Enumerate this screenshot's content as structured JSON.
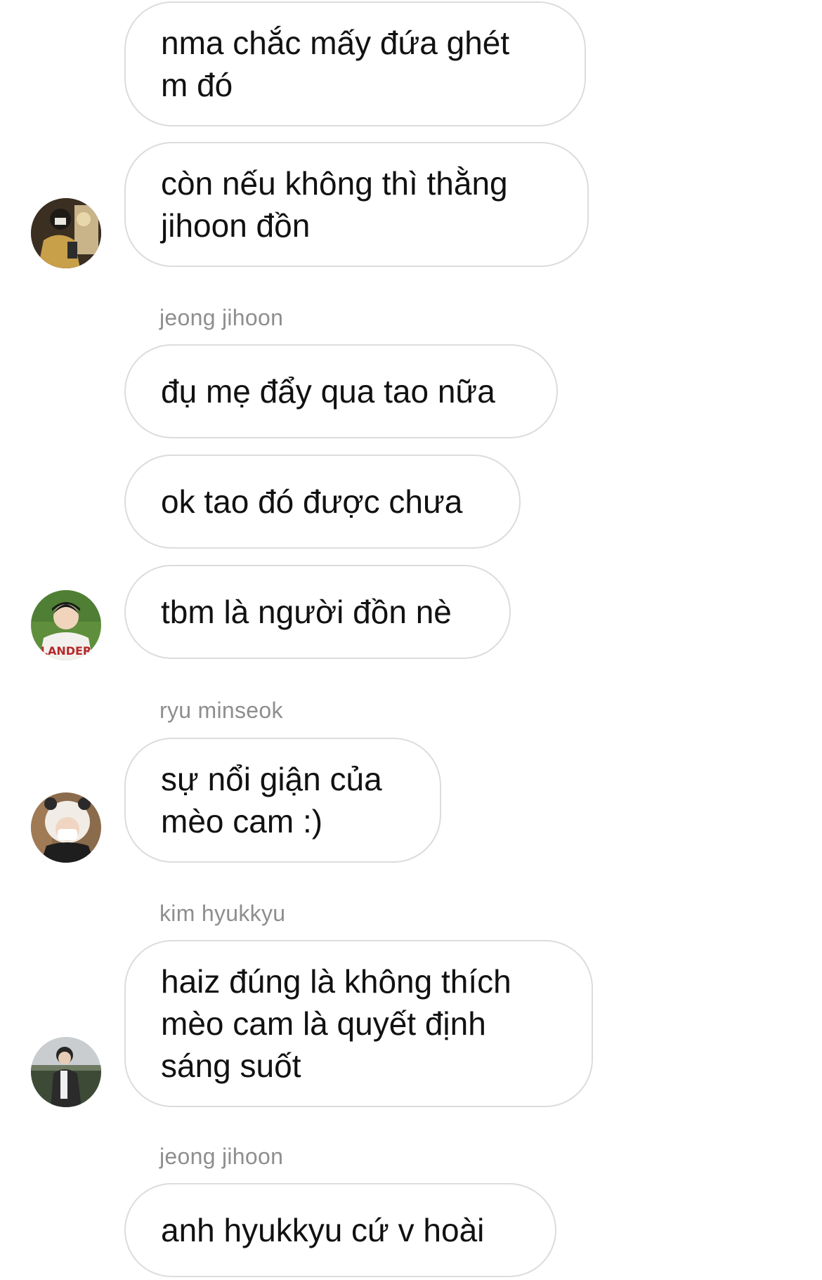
{
  "messages": [
    {
      "text": "nma chắc mấy đứa ghét\nm đó"
    },
    {
      "text": "còn nếu không thì thằng\njihoon đồn"
    },
    {
      "sender": "jeong jihoon",
      "text": "đụ mẹ đẩy qua tao nữa"
    },
    {
      "text": "ok tao đó được chưa"
    },
    {
      "text": "tbm là người đồn nè"
    },
    {
      "sender": "ryu minseok",
      "text": "sự nổi giận của\nmèo cam :)"
    },
    {
      "sender": "kim hyukkyu",
      "text": "haiz đúng là không thích\nmèo cam là quyết định\nsáng suốt"
    },
    {
      "sender": "jeong jihoon",
      "text": "anh hyukkyu cứ v hoài"
    }
  ],
  "avatars": [
    {
      "icon": "user-avatar-photo"
    },
    {
      "icon": "user-avatar-photo"
    },
    {
      "icon": "user-avatar-photo"
    },
    {
      "icon": "user-avatar-photo"
    }
  ]
}
